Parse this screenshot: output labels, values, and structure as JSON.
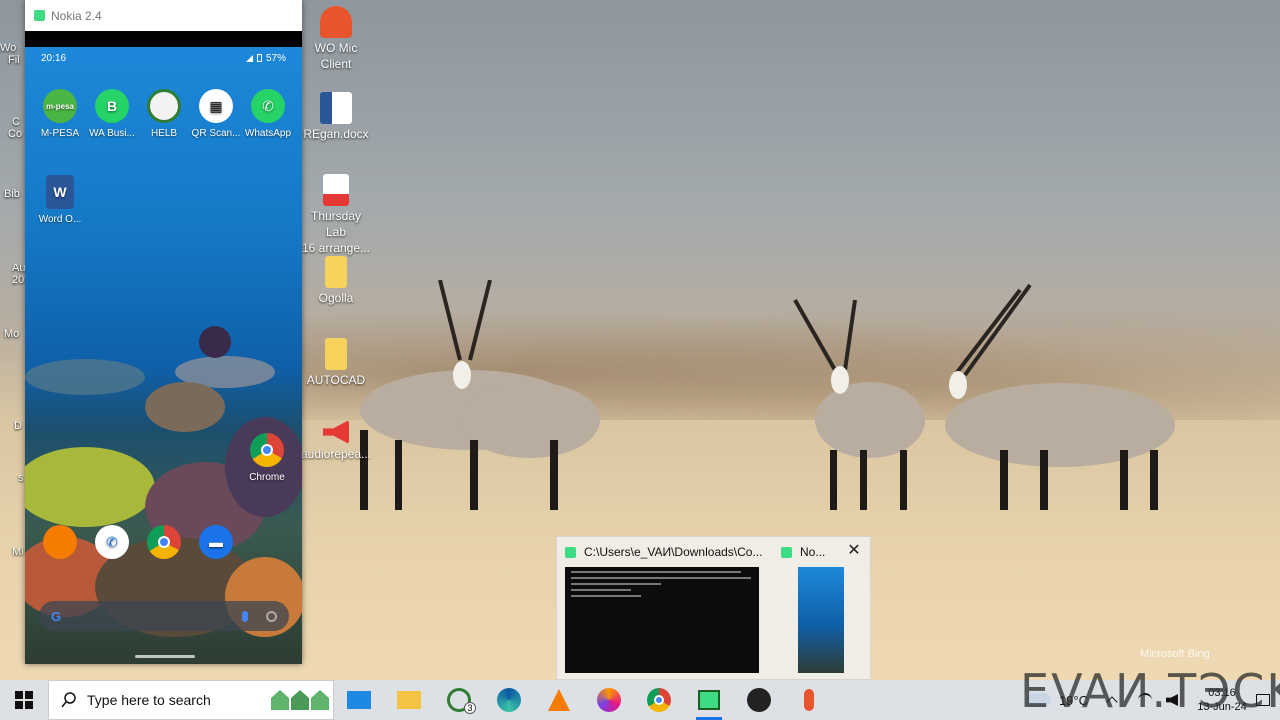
{
  "phone_window": {
    "title": "Nokia 2.4",
    "status_time": "20:16",
    "battery": "57%",
    "apps_row1": [
      {
        "label": "M-PESA",
        "icon": "mpesa-icon",
        "glyph": "m",
        "color": "#4bb543"
      },
      {
        "label": "WA Busi...",
        "icon": "whatsapp-business-icon",
        "glyph": "B",
        "color": "#25d366"
      },
      {
        "label": "HELB",
        "icon": "helb-icon",
        "glyph": "H",
        "color": "#f2f2f2"
      },
      {
        "label": "QR Scan...",
        "icon": "qr-scanner-icon",
        "glyph": "▦",
        "color": "#ffffff"
      },
      {
        "label": "WhatsApp",
        "icon": "whatsapp-icon",
        "glyph": "✆",
        "color": "#25d366"
      }
    ],
    "apps_row2": [
      {
        "label": "Word O...",
        "icon": "word-document-icon",
        "glyph": "W",
        "color": "#2b579a"
      }
    ],
    "chrome_label": "Chrome",
    "dock": [
      {
        "icon": "vlc-icon"
      },
      {
        "icon": "phone-icon"
      },
      {
        "icon": "chrome-icon"
      },
      {
        "icon": "messages-icon"
      }
    ]
  },
  "desktop_icons": [
    {
      "label": "WO Mic\nClient",
      "icon": "wo-mic-icon",
      "color": "#e8552d"
    },
    {
      "label": "REgan.docx",
      "icon": "word-file-icon",
      "color": "#2b579a"
    },
    {
      "label": "Thursday Lab\n16 arrange...",
      "icon": "pdf-file-icon",
      "color": "#e53935"
    },
    {
      "label": "Ogolla",
      "icon": "folder-icon",
      "color": "#f5d25c"
    },
    {
      "label": "AUTOCAD",
      "icon": "folder-icon",
      "color": "#f5d25c"
    },
    {
      "label": "audiorepea...",
      "icon": "audio-file-icon",
      "color": "#e53935"
    }
  ],
  "left_edge_labels": [
    "Wo",
    "Fil",
    "C",
    "Co",
    "Bib",
    "Au",
    "20",
    "Mo",
    "D",
    "s",
    "Mi"
  ],
  "task_preview": {
    "window1_title": "C:\\Users\\e_VAИ\\Downloads\\Co...",
    "window2_title": "No...",
    "close_symbol": "✕"
  },
  "watermarks": {
    "bing": "Microsoft Bing",
    "brand": "EVAИ.TЭCK"
  },
  "taskbar": {
    "search_placeholder": "Type here to search",
    "whatsapp_badge": "3",
    "temperature": "19°C",
    "time": "03:16",
    "date": "13-Jun-24",
    "colors": {
      "accent": "#1a73e8",
      "taskbar_bg": "#dde1e6"
    }
  }
}
